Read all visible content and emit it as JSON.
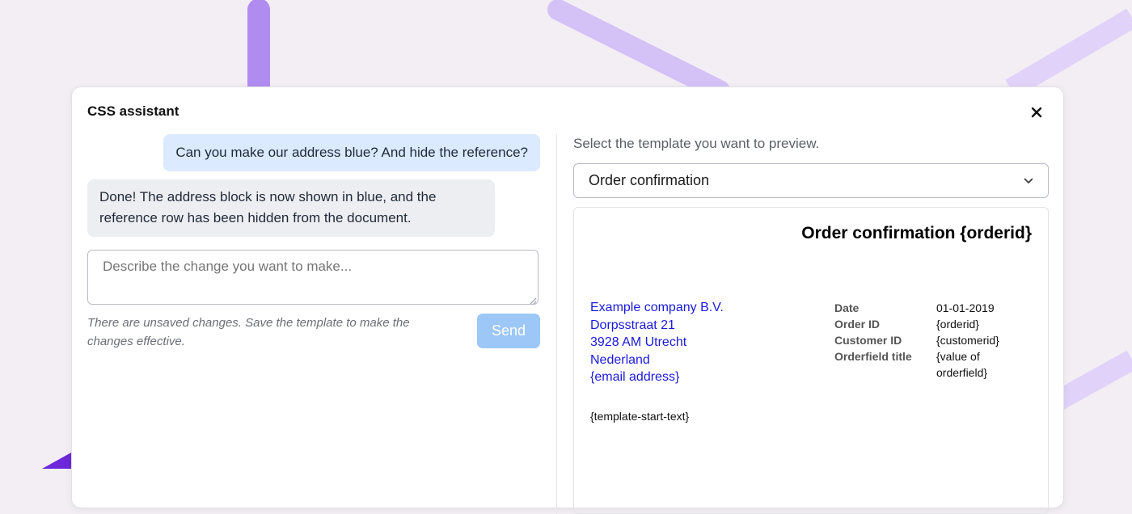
{
  "modal": {
    "title": "CSS assistant"
  },
  "chat": {
    "messages": [
      {
        "role": "user",
        "text": "Can you make our address blue? And hide the reference?"
      },
      {
        "role": "assistant",
        "text": "Done! The address block is now shown in blue, and the reference row has been hidden from the document."
      }
    ],
    "input_placeholder": "Describe the change you want to make...",
    "unsaved_note": "There are unsaved changes. Save the template to make the changes effective.",
    "send_label": "Send"
  },
  "preview": {
    "label": "Select the template you want to preview.",
    "selected_template": "Order confirmation",
    "document": {
      "title": "Order confirmation {orderid}",
      "address_lines": [
        "Example company B.V.",
        "Dorpsstraat 21",
        "3928 AM Utrecht",
        "Nederland",
        "{email address}"
      ],
      "meta": [
        {
          "label": "Date",
          "value": "01-01-2019"
        },
        {
          "label": "Order ID",
          "value": "{orderid}"
        },
        {
          "label": "Customer ID",
          "value": "{customerid}"
        },
        {
          "label": "Orderfield title",
          "value": "{value of orderfield}"
        }
      ],
      "start_text": "{template-start-text}"
    }
  },
  "colors": {
    "background": "#f3eef4",
    "user_bubble": "#dbeafe",
    "assistant_bubble": "#edeef2",
    "send_button": "#9cc7f7",
    "address_text": "#1a1adb",
    "decor_purple": "#b18cf0"
  },
  "icons": {
    "close": "close-icon",
    "select_chevron": "chevron-down-icon",
    "resize": "resize-grip-icon"
  }
}
